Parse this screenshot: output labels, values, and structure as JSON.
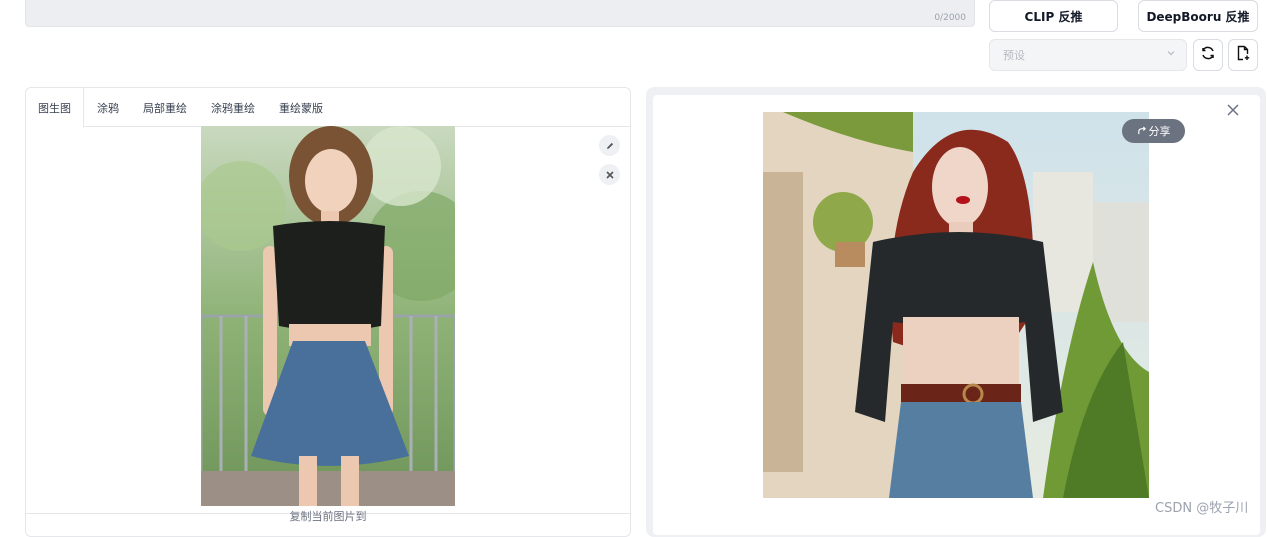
{
  "prompt": {
    "counter": "0/2000"
  },
  "actions": {
    "clip_label": "CLIP 反推",
    "deepbooru_label": "DeepBooru 反推"
  },
  "preset": {
    "placeholder": "预设"
  },
  "tabs": [
    {
      "label": "图生图",
      "active": true
    },
    {
      "label": "涂鸦"
    },
    {
      "label": "局部重绘"
    },
    {
      "label": "涂鸦重绘"
    },
    {
      "label": "重绘蒙版"
    }
  ],
  "input_image": {
    "copy_label": "复制当前图片到"
  },
  "output_image": {
    "share_label": "分享"
  },
  "watermark": "CSDN @牧子川",
  "icons": [
    "edit-icon",
    "clear-icon",
    "refresh-icon",
    "new-file-icon",
    "share-icon",
    "close-icon",
    "chevron-down-icon"
  ],
  "colors": {
    "panel_bg": "#eef0f3",
    "border": "#e5e7eb",
    "share_bg": "#6b7280"
  }
}
